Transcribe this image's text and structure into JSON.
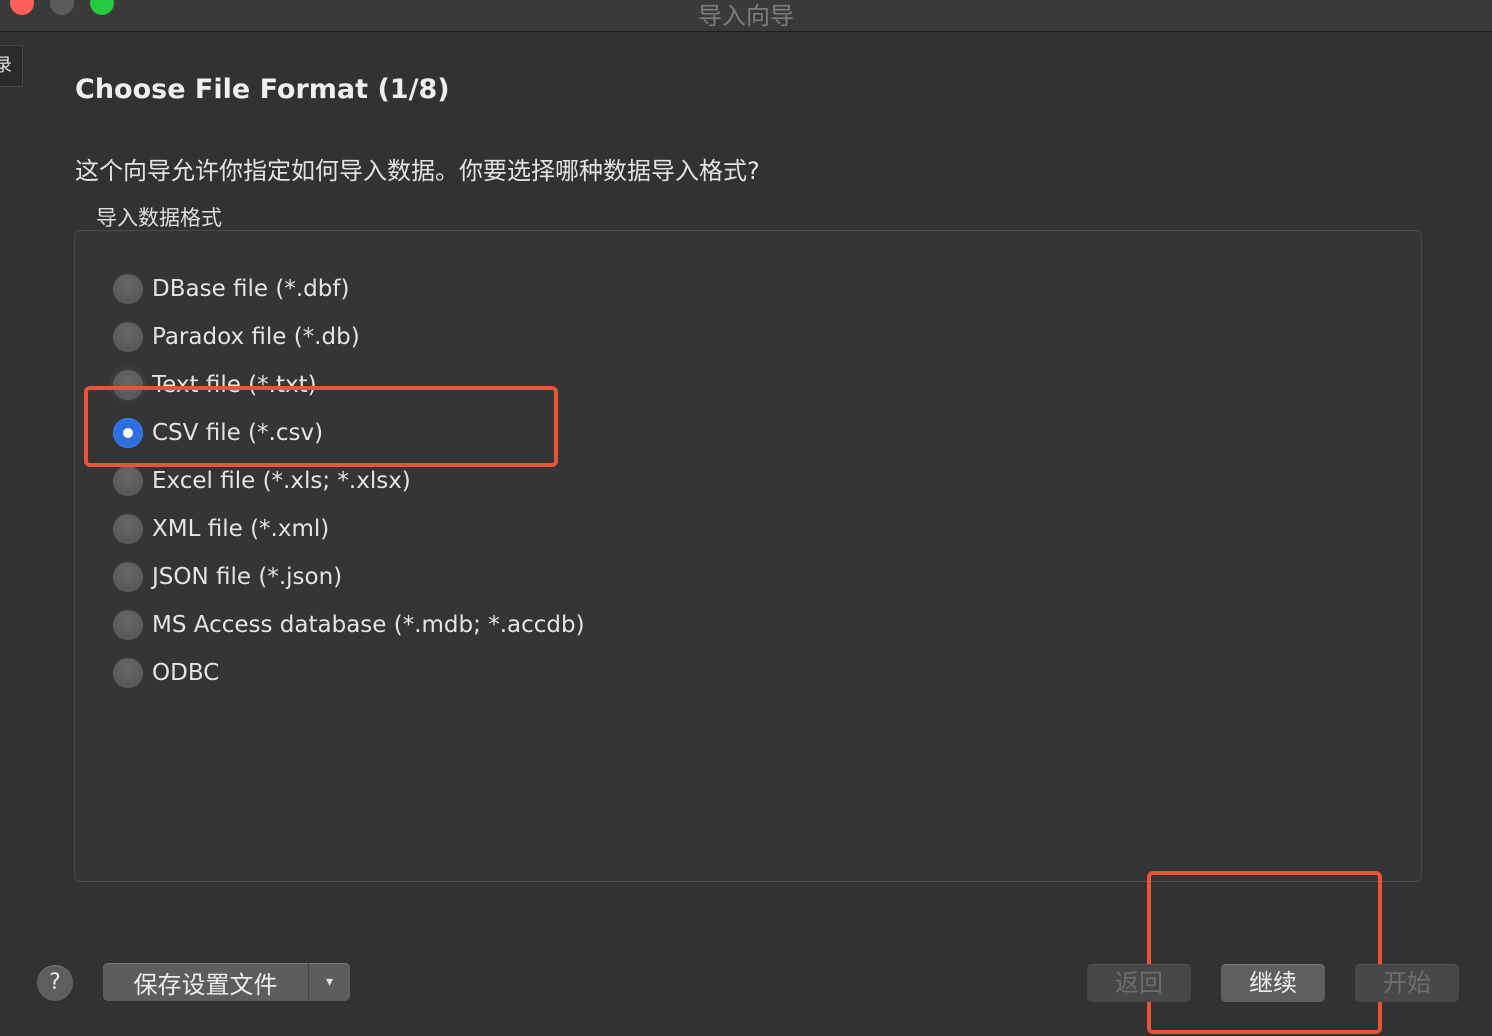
{
  "window": {
    "title": "导入向导"
  },
  "side_tab": {
    "text": "录"
  },
  "page": {
    "title": "Choose File Format (1/8)",
    "description": "这个向导允许你指定如何导入数据。你要选择哪种数据导入格式?"
  },
  "format_group": {
    "label": "导入数据格式",
    "selected": "CSV file (*.csv)",
    "options": [
      {
        "label": "DBase file (*.dbf)"
      },
      {
        "label": "Paradox file (*.db)"
      },
      {
        "label": "Text file (*.txt)"
      },
      {
        "label": "CSV file (*.csv)"
      },
      {
        "label": "Excel file (*.xls; *.xlsx)"
      },
      {
        "label": "XML file (*.xml)"
      },
      {
        "label": "JSON file (*.json)"
      },
      {
        "label": "MS Access database (*.mdb; *.accdb)"
      },
      {
        "label": "ODBC"
      }
    ]
  },
  "footer": {
    "help_label": "?",
    "save_settings_label": "保存设置文件",
    "save_dropdown_glyph": "▾",
    "back_label": "返回",
    "continue_label": "继续",
    "start_label": "开始"
  },
  "colors": {
    "background": "#323232",
    "accent_selected_radio": "#2f6fe0",
    "annotation_box": "#e8533a"
  }
}
